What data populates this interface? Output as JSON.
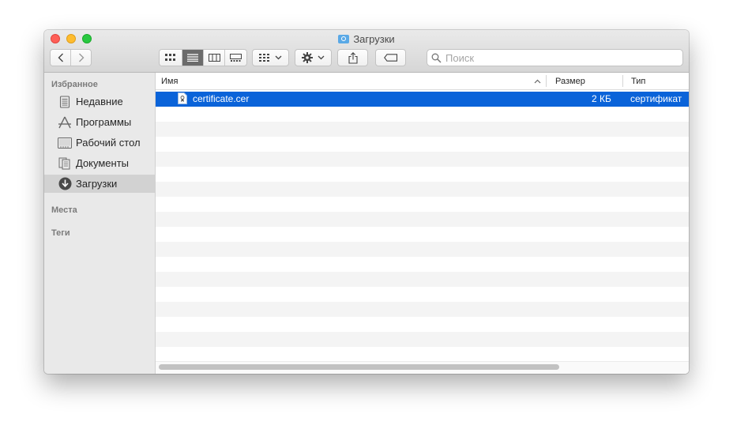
{
  "window": {
    "title": "Загрузки"
  },
  "toolbar": {
    "icons": {
      "back": "chevron-left-icon",
      "forward": "chevron-right-icon",
      "view_icons": "icon-grid-icon",
      "view_list": "list-view-icon",
      "view_columns": "columns-view-icon",
      "view_gallery": "gallery-view-icon",
      "arrange": "arrange-grid-icon",
      "action": "gear-icon",
      "share": "share-icon",
      "tags": "tag-icon"
    },
    "search_placeholder": "Поиск"
  },
  "sidebar": {
    "sections": {
      "favorites": "Избранное",
      "places": "Места",
      "tags": "Теги"
    },
    "items": [
      {
        "label": "Недавние",
        "icon": "recents-icon"
      },
      {
        "label": "Программы",
        "icon": "applications-icon"
      },
      {
        "label": "Рабочий стол",
        "icon": "desktop-icon"
      },
      {
        "label": "Документы",
        "icon": "documents-icon"
      },
      {
        "label": "Загрузки",
        "icon": "downloads-icon",
        "selected": true
      }
    ]
  },
  "table": {
    "columns": {
      "name": "Имя",
      "size": "Размер",
      "kind": "Тип"
    },
    "rows": [
      {
        "name": "certificate.cer",
        "size": "2 КБ",
        "kind": "сертификат",
        "icon": "certificate-file-icon",
        "selected": true
      }
    ]
  },
  "colors": {
    "selection": "#0a63d9",
    "sidebar_bg": "#e9e9e9",
    "close": "#fe5f57",
    "minimize": "#febc2e",
    "zoom": "#28c840"
  }
}
